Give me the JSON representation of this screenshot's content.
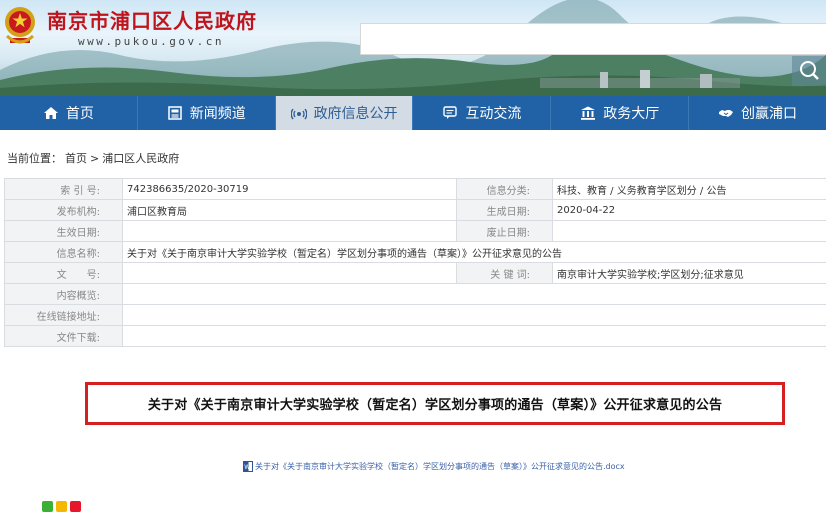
{
  "header": {
    "site_title": "南京市浦口区人民政府",
    "site_url": "www.pukou.gov.cn"
  },
  "nav": [
    {
      "label": "首页",
      "icon": "home-icon"
    },
    {
      "label": "新闻频道",
      "icon": "news-icon"
    },
    {
      "label": "政府信息公开",
      "icon": "broadcast-icon",
      "active": true
    },
    {
      "label": "互动交流",
      "icon": "chat-icon"
    },
    {
      "label": "政务大厅",
      "icon": "building-icon"
    },
    {
      "label": "创赢浦口",
      "icon": "handshake-icon"
    }
  ],
  "breadcrumb": {
    "prefix": "当前位置：",
    "home": "首页",
    "separator": ">",
    "current": "浦口区人民政府"
  },
  "info": {
    "index_label": "索 引 号:",
    "index_value": "742386635/2020-30719",
    "category_label": "信息分类:",
    "category_value": "科技、教育 / 义务教育学区划分 / 公告",
    "publisher_label": "发布机构:",
    "publisher_value": "浦口区教育局",
    "created_label": "生成日期:",
    "created_value": "2020-04-22",
    "effective_label": "生效日期:",
    "effective_value": "",
    "expire_label": "废止日期:",
    "expire_value": "",
    "name_label": "信息名称:",
    "name_value": "关于对《关于南京审计大学实验学校（暂定名）学区划分事项的通告（草案）》公开征求意见的公告",
    "docno_label": "文　　号:",
    "docno_value": "",
    "keywords_label": "关 键 词:",
    "keywords_value": "南京审计大学实验学校;学区划分;征求意见",
    "summary_label": "内容概览:",
    "summary_value": "",
    "link_label": "在线链接地址:",
    "link_value": "",
    "download_label": "文件下载:",
    "download_value": ""
  },
  "content": {
    "title": "关于对《关于南京审计大学实验学校（暂定名）学区划分事项的通告（草案）》公开征求意见的公告",
    "attachment": "关于对《关于南京审计大学实验学校（暂定名）学区划分事项的通告（草案）》公开征求意见的公告.docx"
  },
  "colors": {
    "nav_bg": "#2161a5",
    "nav_active_bg": "#d3dbe4",
    "title_red": "#c0141c",
    "highlight_border": "#d42020"
  }
}
